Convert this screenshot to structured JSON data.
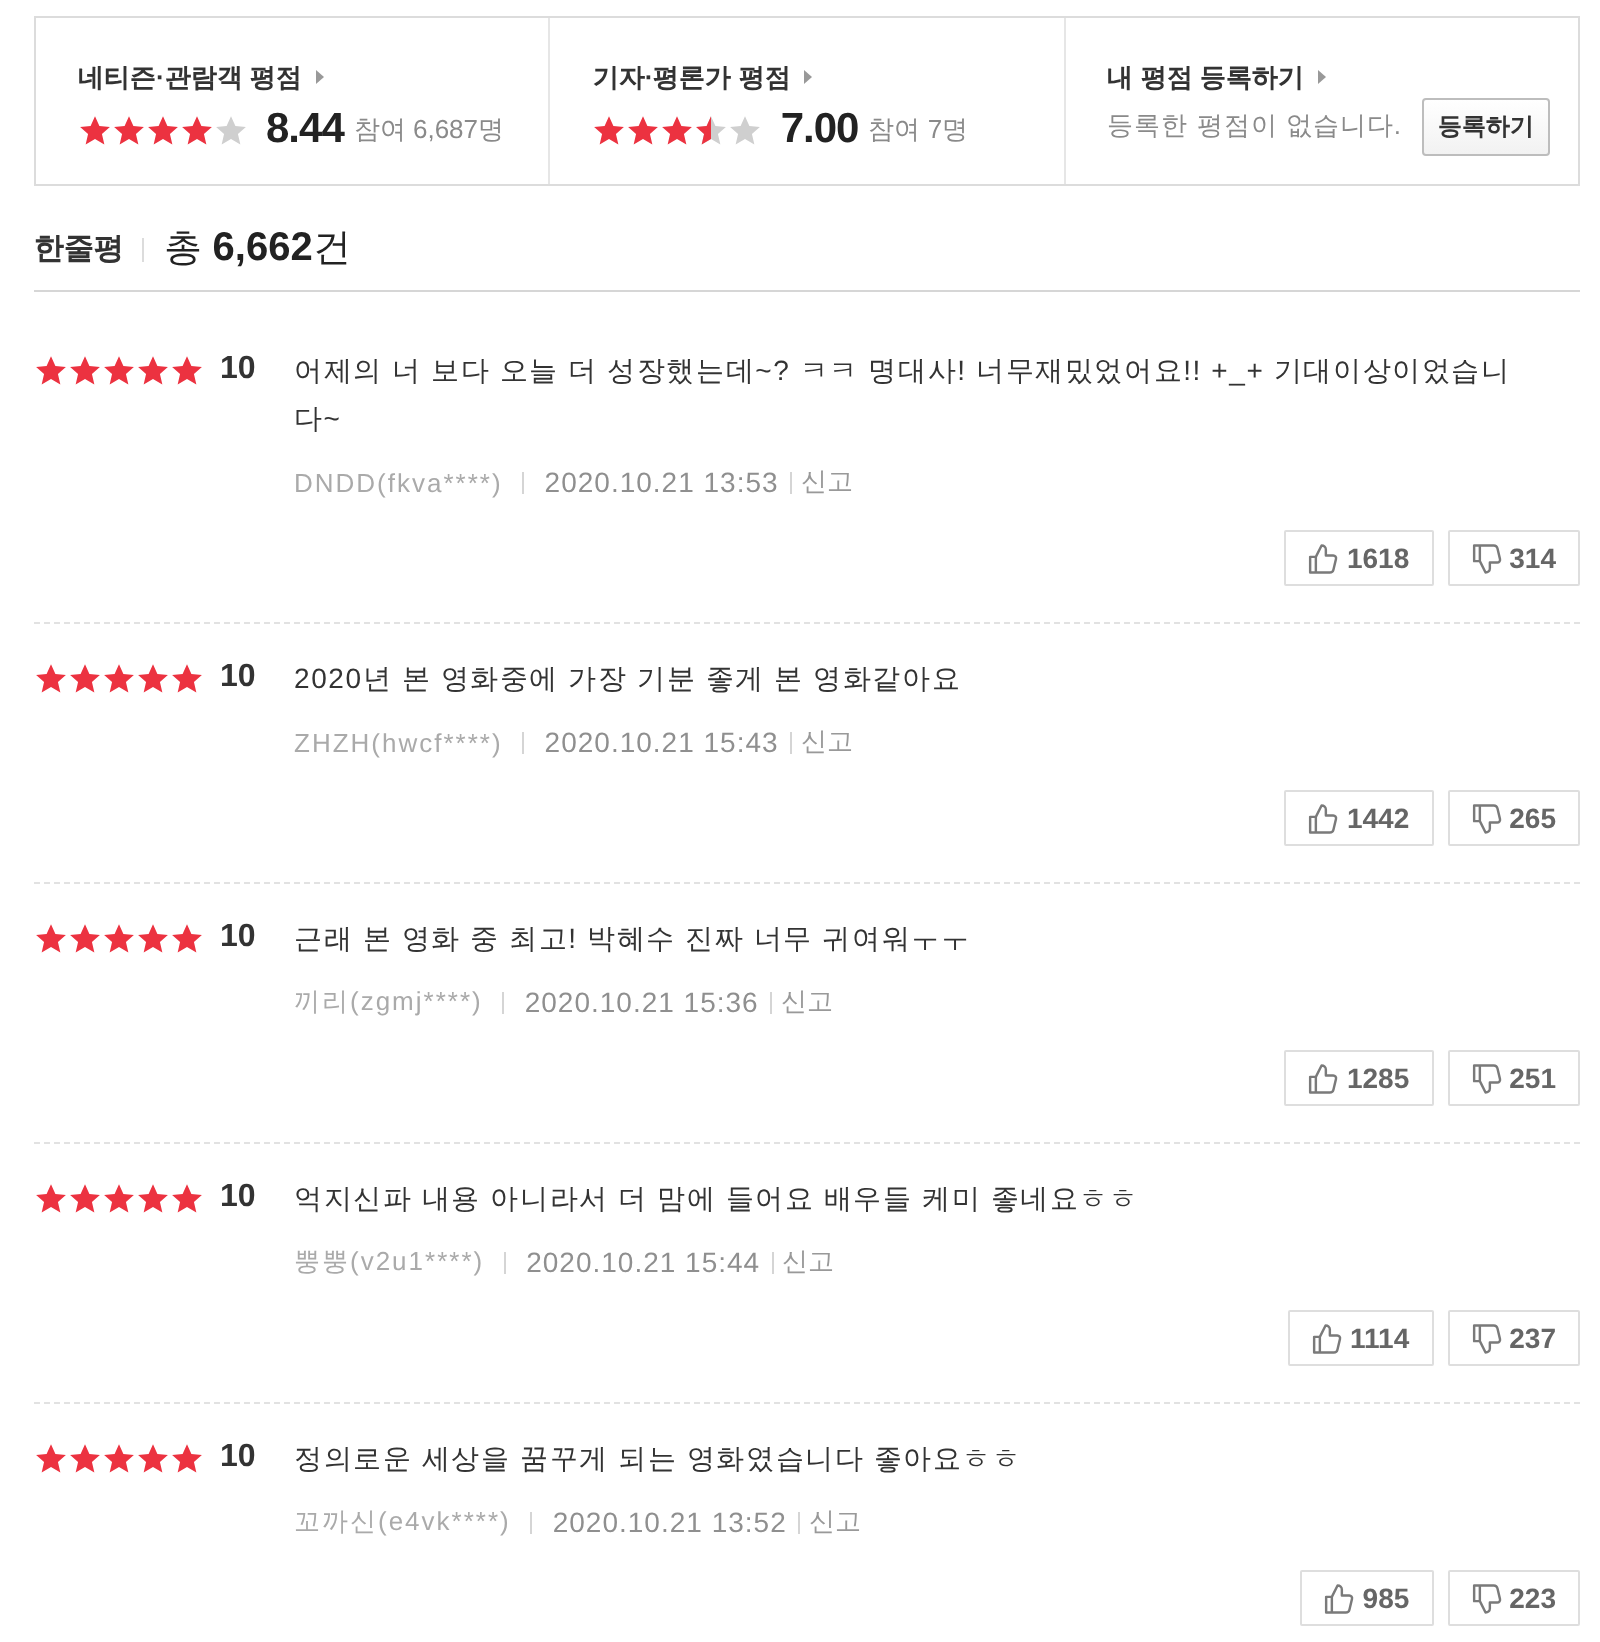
{
  "rating_summary": [
    {
      "kind": "score",
      "label": "네티즌·관람객 평점",
      "stars": 4,
      "score": "8.44",
      "participants": "참여 6,687명"
    },
    {
      "kind": "score",
      "label": "기자·평론가 평점",
      "stars": 3.5,
      "score": "7.00",
      "participants": "참여 7명"
    },
    {
      "kind": "register",
      "label": "내 평점 등록하기",
      "message": "등록한 평점이 없습니다.",
      "button": "등록하기"
    }
  ],
  "review_header": {
    "title": "한줄평",
    "total": "총 **6,662**건"
  },
  "reviews": [
    {
      "stars": 5,
      "score": "10",
      "text": "어제의 너 보다 오늘 더 성장했는데~? ㅋㅋ 명대사! 너무재밌었어요!! +_+ 기대이상이었습니다~",
      "author": "DNDD(fkva****)",
      "date": "2020.10.21 13:53",
      "report": "신고",
      "likes": "1618",
      "dislikes": "314"
    },
    {
      "stars": 5,
      "score": "10",
      "text": "2020년 본 영화중에 가장 기분 좋게 본 영화같아요",
      "author": "ZHZH(hwcf****)",
      "date": "2020.10.21 15:43",
      "report": "신고",
      "likes": "1442",
      "dislikes": "265"
    },
    {
      "stars": 5,
      "score": "10",
      "text": "근래 본 영화 중 최고! 박혜수 진짜 너무 귀여워ㅜㅜ",
      "author": "끼리(zgmj****)",
      "date": "2020.10.21 15:36",
      "report": "신고",
      "likes": "1285",
      "dislikes": "251"
    },
    {
      "stars": 5,
      "score": "10",
      "text": "억지신파 내용 아니라서 더 맘에 들어요 배우들 케미 좋네요ㅎㅎ",
      "author": "뿡뿡(v2u1****)",
      "date": "2020.10.21 15:44",
      "report": "신고",
      "likes": "1114",
      "dislikes": "237"
    },
    {
      "stars": 5,
      "score": "10",
      "text": "정의로운 세상을 꿈꾸게 되는 영화였습니다 좋아요ㅎㅎ",
      "author": "꼬까신(e4vk****)",
      "date": "2020.10.21 13:52",
      "report": "신고",
      "likes": "985",
      "dislikes": "223"
    }
  ]
}
